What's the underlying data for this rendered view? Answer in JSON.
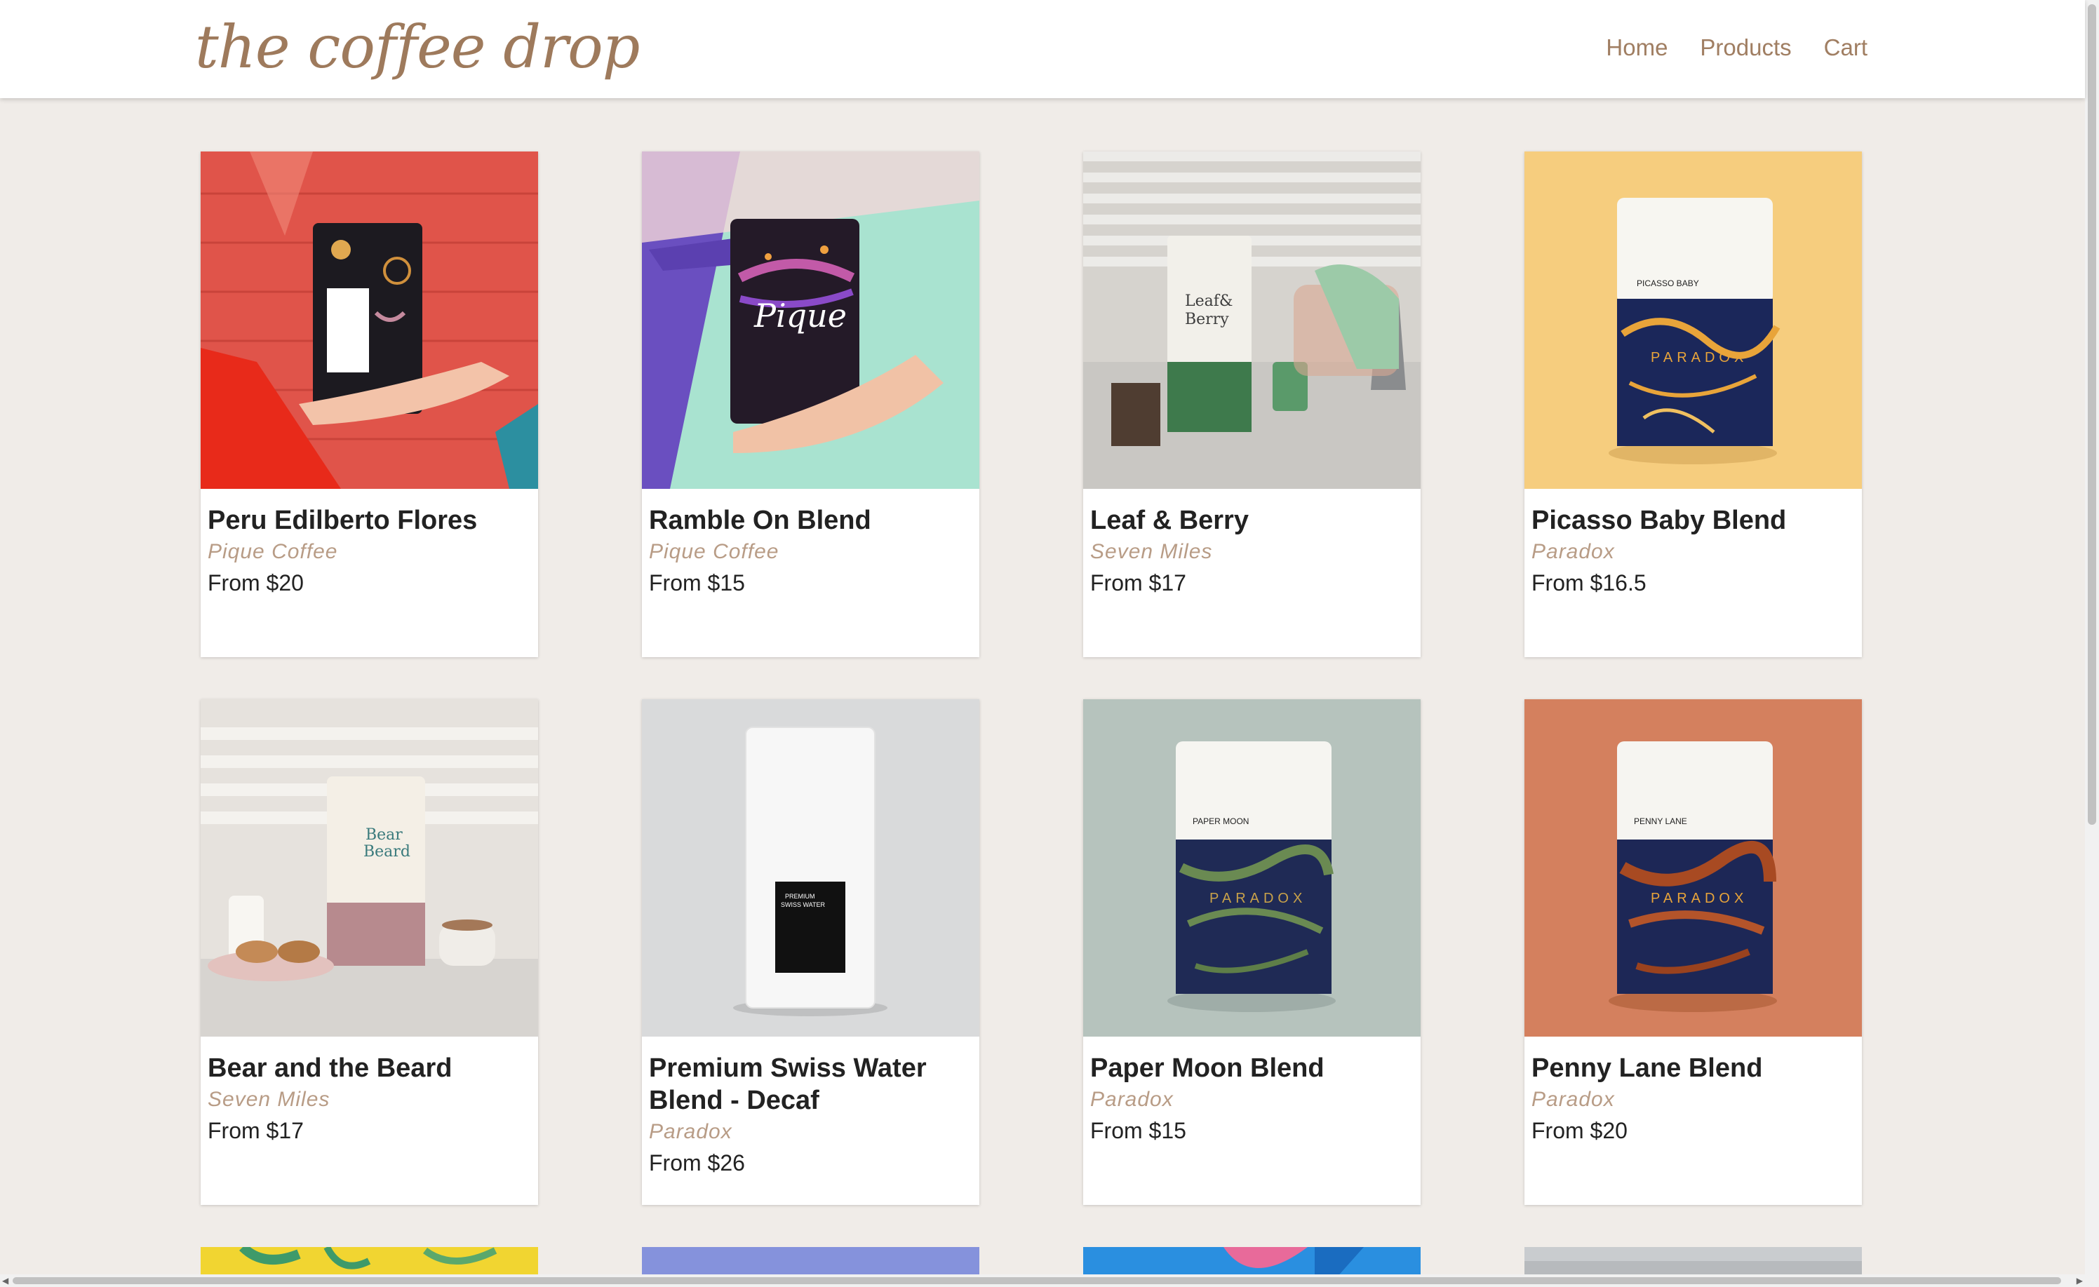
{
  "header": {
    "logo": "the coffee drop",
    "nav": [
      "Home",
      "Products",
      "Cart"
    ]
  },
  "products": [
    {
      "name": "Peru Edilberto Flores",
      "roaster": "Pique Coffee",
      "price": "From $20"
    },
    {
      "name": "Ramble On Blend",
      "roaster": "Pique Coffee",
      "price": "From $15"
    },
    {
      "name": "Leaf & Berry",
      "roaster": "Seven Miles",
      "price": "From $17"
    },
    {
      "name": "Picasso Baby Blend",
      "roaster": "Paradox",
      "price": "From $16.5"
    },
    {
      "name": "Bear and the Beard",
      "roaster": "Seven Miles",
      "price": "From $17"
    },
    {
      "name": "Premium Swiss Water Blend - Decaf",
      "roaster": "Paradox",
      "price": "From $26"
    },
    {
      "name": "Paper Moon Blend",
      "roaster": "Paradox",
      "price": "From $15"
    },
    {
      "name": "Penny Lane Blend",
      "roaster": "Paradox",
      "price": "From $20"
    }
  ],
  "colors": {
    "brand": "#9e7a5c",
    "page_bg": "#f0ece8",
    "roaster_text": "#b89c86"
  }
}
